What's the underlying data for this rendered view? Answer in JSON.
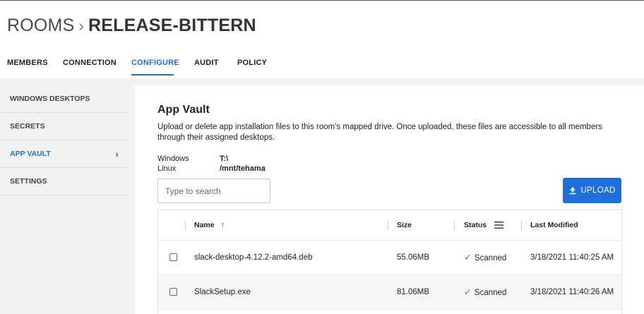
{
  "header": {
    "crumb": "ROOMS",
    "separator": "›",
    "room": "RELEASE-BITTERN"
  },
  "tabs": [
    {
      "label": "MEMBERS",
      "active": false
    },
    {
      "label": "CONNECTION",
      "active": false
    },
    {
      "label": "CONFIGURE",
      "active": true
    },
    {
      "label": "AUDIT",
      "active": false
    },
    {
      "label": "POLICY",
      "active": false
    }
  ],
  "sidebar": {
    "items": [
      {
        "label": "WINDOWS DESKTOPS",
        "active": false
      },
      {
        "label": "SECRETS",
        "active": false
      },
      {
        "label": "APP VAULT",
        "active": true
      },
      {
        "label": "SETTINGS",
        "active": false
      }
    ],
    "active_chevron": "›"
  },
  "vault": {
    "title": "App Vault",
    "description": "Upload or delete app installation files to this room's mapped drive. Once uploaded, these files are accessible to all members through their assigned desktops.",
    "drives": [
      {
        "os": "Windows",
        "path": "T:\\"
      },
      {
        "os": "Linux",
        "path": "/mnt/tehama"
      }
    ],
    "search": {
      "placeholder": "Type to search",
      "value": ""
    },
    "upload_label": "UPLOAD",
    "upload_icon": "upload-icon"
  },
  "table": {
    "columns": {
      "name": "Name",
      "name_sort": "↑",
      "size": "Size",
      "status": "Status",
      "modified": "Last Modified"
    },
    "rows": [
      {
        "name": "slack-desktop-4.12.2-amd64.deb",
        "size": "55.06MB",
        "status": "Scanned",
        "modified": "3/18/2021 11:40:25 AM"
      },
      {
        "name": "SlackSetup.exe",
        "size": "81.06MB",
        "status": "Scanned",
        "modified": "3/18/2021 11:40:26 AM"
      }
    ]
  },
  "colors": {
    "accent": "#1e6fd9",
    "success": "#2e9e3c",
    "background_gray": "#f2f2f2"
  }
}
